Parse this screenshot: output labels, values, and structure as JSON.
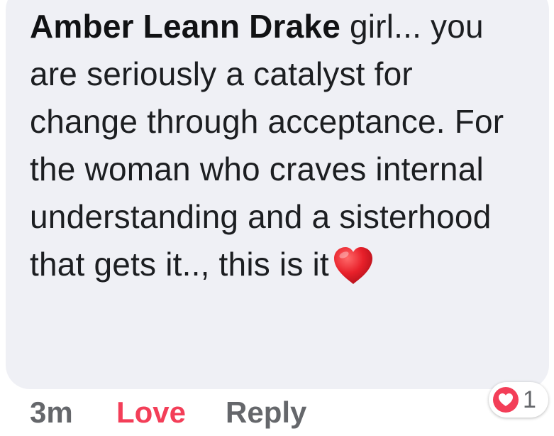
{
  "comment": {
    "author": "Amber Leann Drake",
    "text": "girl... you are seriously a catalyst for change through acceptance. For the woman who craves internal understanding and a sisterhood that gets it.., this is it",
    "emoji": "red-heart"
  },
  "actions": {
    "timestamp": "3m",
    "love_label": "Love",
    "reply_label": "Reply"
  },
  "reactions": {
    "type": "love",
    "count": "1"
  },
  "colors": {
    "bubble_background": "#eff0f5",
    "love_accent": "#f33e58",
    "secondary_text": "#65676b",
    "primary_text": "#1c1e21"
  }
}
